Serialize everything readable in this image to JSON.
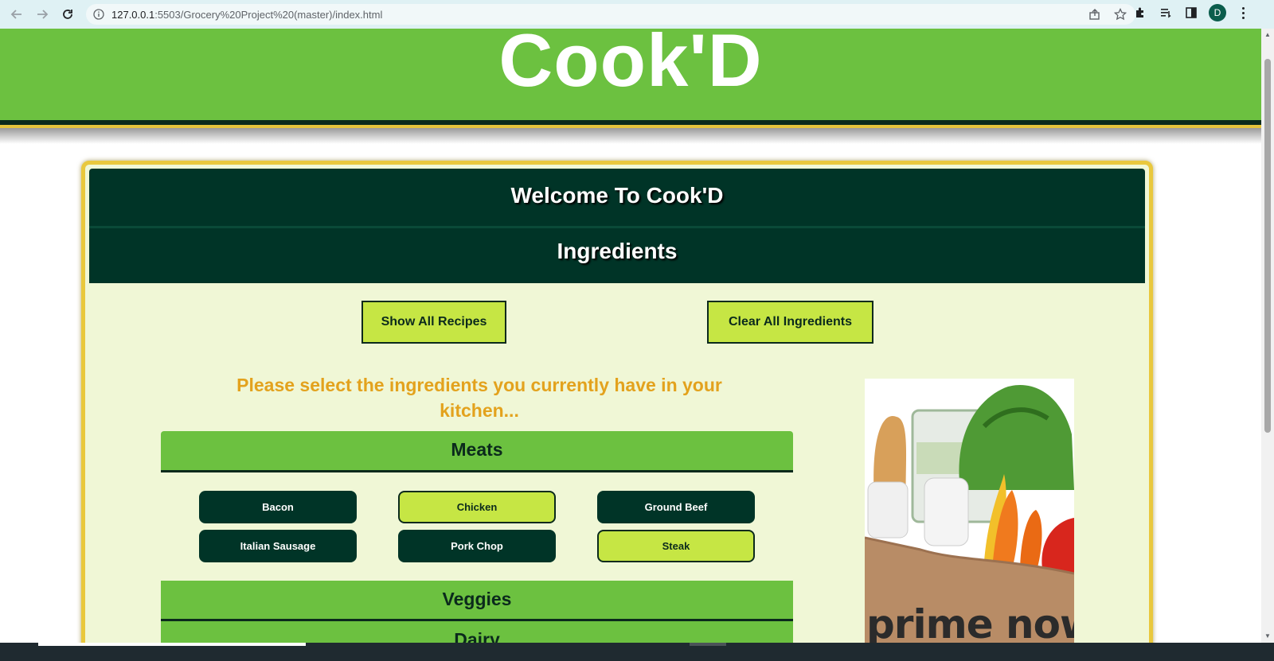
{
  "browser": {
    "url_host": "127.0.0.1",
    "url_rest": ":5503/Grocery%20Project%20(master)/index.html",
    "profile_initial": "D",
    "icons": [
      "back-icon",
      "forward-icon",
      "reload-icon",
      "info-icon",
      "share-icon",
      "star-icon",
      "extensions-icon",
      "reading-list-icon",
      "side-panel-icon",
      "menu-icon"
    ]
  },
  "header": {
    "brand": "Cook'D"
  },
  "card": {
    "welcome": "Welcome To Cook'D",
    "section_title": "Ingredients",
    "buttons": {
      "show_all": "Show All Recipes",
      "clear_all": "Clear All Ingredients"
    },
    "prompt": "Please select the ingredients you currently have in your kitchen...",
    "sections": {
      "meats": "Meats",
      "veggies": "Veggies",
      "dairy": "Dairy"
    },
    "meats_items": [
      {
        "label": "Bacon",
        "selected": false
      },
      {
        "label": "Chicken",
        "selected": true
      },
      {
        "label": "Ground Beef",
        "selected": false
      },
      {
        "label": "Italian Sausage",
        "selected": false
      },
      {
        "label": "Pork Chop",
        "selected": false
      },
      {
        "label": "Steak",
        "selected": true
      }
    ],
    "ad_text": "prime now"
  },
  "colors": {
    "header_green": "#6cc140",
    "dark_green": "#003427",
    "lime": "#c6e644",
    "gold": "#e9c83d",
    "prompt_orange": "#e3a21d",
    "card_bg": "#f0f7d6"
  }
}
